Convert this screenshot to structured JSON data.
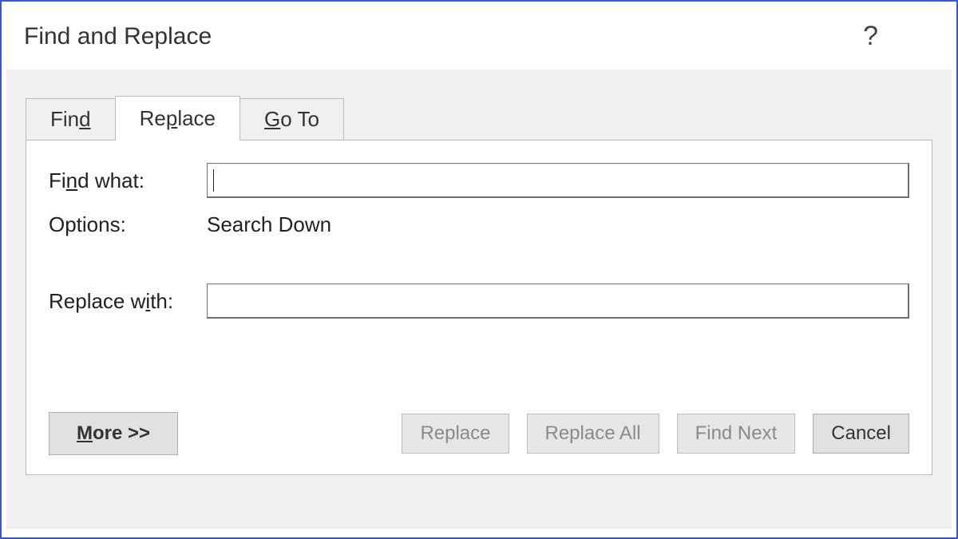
{
  "dialog": {
    "title": "Find and Replace",
    "help_label": "?"
  },
  "tabs": {
    "find": "Find",
    "replace": "Replace",
    "goto": "Go To",
    "active": "replace"
  },
  "form": {
    "find_what_label": "Find what:",
    "find_what_value": "",
    "options_label": "Options:",
    "options_value": "Search Down",
    "replace_with_label": "Replace with:",
    "replace_with_value": ""
  },
  "buttons": {
    "more": "More >>",
    "replace": "Replace",
    "replace_all": "Replace All",
    "find_next": "Find Next",
    "cancel": "Cancel"
  }
}
